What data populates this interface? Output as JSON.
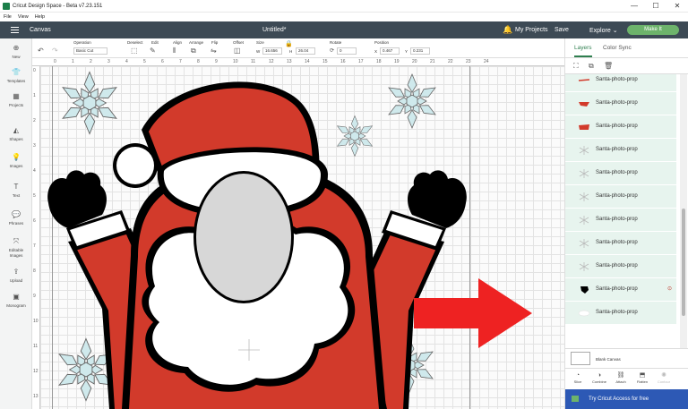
{
  "window": {
    "title": "Cricut Design Space - Beta v7.23.151",
    "controls": [
      "—",
      "☐",
      "✕"
    ]
  },
  "menu": [
    "File",
    "View",
    "Help"
  ],
  "header": {
    "section": "Canvas",
    "doc_title": "Untitled*",
    "my_projects": "My Projects",
    "save": "Save",
    "explore": "Explore",
    "make_it": "Make It"
  },
  "sidebar": {
    "items": [
      {
        "label": "New",
        "icon": "plus-icon"
      },
      {
        "label": "Templates",
        "icon": "shirt-icon"
      },
      {
        "label": "Projects",
        "icon": "grid-icon"
      },
      {
        "label": "Shapes",
        "icon": "shapes-icon"
      },
      {
        "label": "Images",
        "icon": "bulb-icon"
      },
      {
        "label": "Text",
        "icon": "text-icon"
      },
      {
        "label": "Phrases",
        "icon": "speech-icon"
      },
      {
        "label": "Editable Images",
        "icon": "editable-icon"
      },
      {
        "label": "Upload",
        "icon": "upload-icon"
      },
      {
        "label": "Monogram",
        "icon": "monogram-icon"
      }
    ]
  },
  "toolbar": {
    "operation_label": "Operation",
    "operation_value": "Basic Cut",
    "deselect": "Deselect",
    "edit": "Edit",
    "align": "Align",
    "arrange": "Arrange",
    "flip": "Flip",
    "offset": "Offset",
    "size_label": "Size",
    "w_label": "W",
    "w_value": "16.656",
    "h_label": "H",
    "h_value": "26.04",
    "rotate_label": "Rotate",
    "rotate_value": "0",
    "position_label": "Position",
    "x_label": "X",
    "x_value": "0.467",
    "y_label": "Y",
    "y_value": "0.231"
  },
  "ruler": {
    "top_ticks": [
      "0",
      "1",
      "2",
      "3",
      "4",
      "5",
      "6",
      "7",
      "8",
      "9",
      "10",
      "11",
      "12",
      "13",
      "14",
      "15",
      "16",
      "17",
      "18",
      "19",
      "20",
      "21",
      "22",
      "23",
      "24"
    ],
    "left_ticks": [
      "0",
      "1",
      "2",
      "3",
      "4",
      "5",
      "6",
      "7",
      "8",
      "9",
      "10",
      "11",
      "12",
      "13"
    ]
  },
  "right_panel": {
    "tabs": [
      "Layers",
      "Color Sync"
    ],
    "layers": [
      {
        "name": "Santa-photo-prop",
        "thumb": "red-line"
      },
      {
        "name": "Santa-photo-prop",
        "thumb": "red-shape"
      },
      {
        "name": "Santa-photo-prop",
        "thumb": "red-hat"
      },
      {
        "name": "Santa-photo-prop",
        "thumb": "snowflake"
      },
      {
        "name": "Santa-photo-prop",
        "thumb": "snowflake"
      },
      {
        "name": "Santa-photo-prop",
        "thumb": "snowflake"
      },
      {
        "name": "Santa-photo-prop",
        "thumb": "snowflake"
      },
      {
        "name": "Santa-photo-prop",
        "thumb": "snowflake"
      },
      {
        "name": "Santa-photo-prop",
        "thumb": "snowflake"
      },
      {
        "name": "Santa-photo-prop",
        "thumb": "black-glove"
      },
      {
        "name": "Santa-photo-prop",
        "thumb": "white-shape"
      }
    ],
    "blank_canvas": "Blank Canvas",
    "actions": [
      "Slice",
      "Combine",
      "Attach",
      "Flatten",
      "Contour"
    ],
    "promo": "Try Cricut Access for free"
  },
  "colors": {
    "header_bg": "#3d4a55",
    "make_it": "#6db36b",
    "santa_red": "#d23a2b",
    "layer_row": "#e7f4ee",
    "promo_bg": "#2d59b5",
    "arrow": "#ee2222"
  }
}
